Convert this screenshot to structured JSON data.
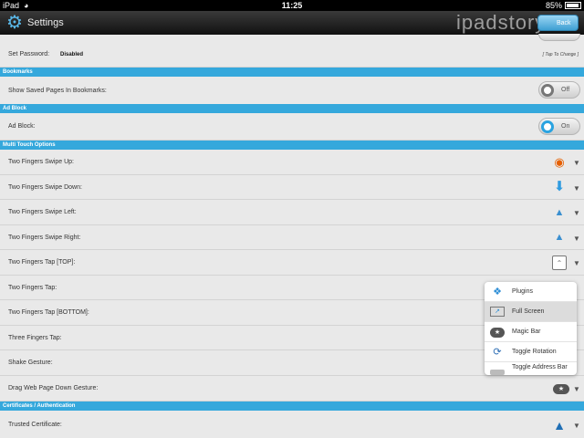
{
  "status_bar": {
    "carrier": "iPad",
    "time": "11:25",
    "battery": "85%"
  },
  "title_bar": {
    "title": "Settings",
    "watermark": "ipadstory.ru",
    "back_label": "Back"
  },
  "password_row": {
    "label": "Set Password:",
    "value": "Disabled",
    "hint": "[ Tap To Change ]"
  },
  "sections": {
    "bookmarks": "Bookmarks",
    "ad_block": "Ad Block",
    "multi_touch": "Multi Touch Options",
    "certificates": "Certificates / Authentication"
  },
  "bookmarks_row": {
    "label": "Show Saved Pages In Bookmarks:",
    "toggle": "Off"
  },
  "ad_block_row": {
    "label": "Ad Block:",
    "toggle": "On"
  },
  "gestures": [
    {
      "label": "Two Fingers Swipe Up:",
      "icon": "firefox-icon"
    },
    {
      "label": "Two Fingers Swipe Down:",
      "icon": "arrow-down-icon"
    },
    {
      "label": "Two Fingers Swipe Left:",
      "icon": "tab-left-icon"
    },
    {
      "label": "Two Fingers Swipe Right:",
      "icon": "tab-right-icon"
    },
    {
      "label": "Two Fingers Tap [TOP]:",
      "icon": "scroll-top-icon"
    },
    {
      "label": "Two Fingers Tap:",
      "icon": ""
    },
    {
      "label": "Two Fingers Tap [BOTTOM]:",
      "icon": ""
    },
    {
      "label": "Three Fingers Tap:",
      "icon": ""
    },
    {
      "label": "Shake Gesture:",
      "icon": ""
    },
    {
      "label": "Drag Web Page Down Gesture:",
      "icon": "magic-bar-icon"
    }
  ],
  "certificate_row": {
    "label": "Trusted Certificate:",
    "icon": "warning-icon"
  },
  "popup_menu": {
    "items": [
      {
        "label": "Plugins",
        "icon": "puzzle-icon"
      },
      {
        "label": "Full Screen",
        "icon": "fullscreen-icon"
      },
      {
        "label": "Magic Bar",
        "icon": "magic-bar-icon"
      },
      {
        "label": "Toggle Rotation",
        "icon": "rotation-lock-icon"
      },
      {
        "label": "Toggle Address Bar",
        "icon": "address-bar-icon"
      }
    ],
    "selected_index": 1
  },
  "colors": {
    "section_blue": "#35a8dc",
    "toggle_on": "#2aa3e0",
    "background": "#e9e9e9"
  }
}
